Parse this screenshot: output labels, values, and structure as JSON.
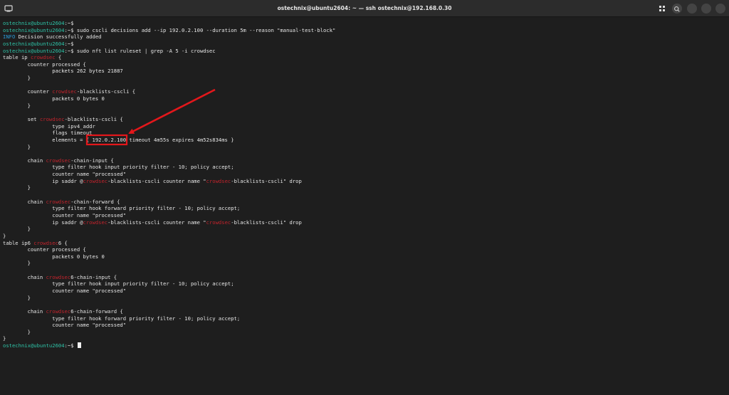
{
  "window": {
    "title": "ostechnix@ubuntu2604: ~ — ssh ostechnix@192.168.0.30"
  },
  "colors": {
    "prompt": "#2ec4a8",
    "info": "#2a9bd8",
    "highlight": "#c0232c",
    "annotation": "#e3171b"
  },
  "terminal": {
    "lines": [
      [
        {
          "t": "ostechnix@ubuntu2604",
          "c": "prompt"
        },
        {
          "t": ":~$"
        }
      ],
      [
        {
          "t": "ostechnix@ubuntu2604",
          "c": "prompt"
        },
        {
          "t": ":~$ sudo cscli decisions add --ip 192.0.2.100 --duration 5m --reason \"manual-test-block\""
        }
      ],
      [
        {
          "t": "INFO",
          "c": "info"
        },
        {
          "t": " Decision successfully added"
        }
      ],
      [
        {
          "t": "ostechnix@ubuntu2604",
          "c": "prompt"
        },
        {
          "t": ":~$"
        }
      ],
      [
        {
          "t": "ostechnix@ubuntu2604",
          "c": "prompt"
        },
        {
          "t": ":~$ sudo nft list ruleset | grep -A 5 -i crowdsec"
        }
      ],
      [
        {
          "t": "table ip "
        },
        {
          "t": "crowdsec",
          "c": "red"
        },
        {
          "t": " {"
        }
      ],
      [
        {
          "t": "        counter processed {"
        }
      ],
      [
        {
          "t": "                packets 262 bytes 21887"
        }
      ],
      [
        {
          "t": "        }"
        }
      ],
      [
        {
          "t": ""
        }
      ],
      [
        {
          "t": "        counter "
        },
        {
          "t": "crowdsec",
          "c": "red"
        },
        {
          "t": "-blacklists-cscli {"
        }
      ],
      [
        {
          "t": "                packets 0 bytes 0"
        }
      ],
      [
        {
          "t": "        }"
        }
      ],
      [
        {
          "t": ""
        }
      ],
      [
        {
          "t": "        set "
        },
        {
          "t": "crowdsec",
          "c": "red"
        },
        {
          "t": "-blacklists-cscli {"
        }
      ],
      [
        {
          "t": "                type ipv4_addr"
        }
      ],
      [
        {
          "t": "                flags timeout"
        }
      ],
      [
        {
          "t": "                elements = { 192.0.2.100 timeout 4m55s expires 4m52s834ms }"
        }
      ],
      [
        {
          "t": "        }"
        }
      ],
      [
        {
          "t": ""
        }
      ],
      [
        {
          "t": "        chain "
        },
        {
          "t": "crowdsec",
          "c": "red"
        },
        {
          "t": "-chain-input {"
        }
      ],
      [
        {
          "t": "                type filter hook input priority filter - 10; policy accept;"
        }
      ],
      [
        {
          "t": "                counter name \"processed\""
        }
      ],
      [
        {
          "t": "                ip saddr @"
        },
        {
          "t": "crowdsec",
          "c": "red"
        },
        {
          "t": "-blacklists-cscli counter name \""
        },
        {
          "t": "crowdsec",
          "c": "red"
        },
        {
          "t": "-blacklists-cscli\" drop"
        }
      ],
      [
        {
          "t": "        }"
        }
      ],
      [
        {
          "t": ""
        }
      ],
      [
        {
          "t": "        chain "
        },
        {
          "t": "crowdsec",
          "c": "red"
        },
        {
          "t": "-chain-forward {"
        }
      ],
      [
        {
          "t": "                type filter hook forward priority filter - 10; policy accept;"
        }
      ],
      [
        {
          "t": "                counter name \"processed\""
        }
      ],
      [
        {
          "t": "                ip saddr @"
        },
        {
          "t": "crowdsec",
          "c": "red"
        },
        {
          "t": "-blacklists-cscli counter name \""
        },
        {
          "t": "crowdsec",
          "c": "red"
        },
        {
          "t": "-blacklists-cscli\" drop"
        }
      ],
      [
        {
          "t": "        }"
        }
      ],
      [
        {
          "t": "}"
        }
      ],
      [
        {
          "t": "table ip6 "
        },
        {
          "t": "crowdsec",
          "c": "red"
        },
        {
          "t": "6 {"
        }
      ],
      [
        {
          "t": "        counter processed {"
        }
      ],
      [
        {
          "t": "                packets 0 bytes 0"
        }
      ],
      [
        {
          "t": "        }"
        }
      ],
      [
        {
          "t": ""
        }
      ],
      [
        {
          "t": "        chain "
        },
        {
          "t": "crowdsec",
          "c": "red"
        },
        {
          "t": "6-chain-input {"
        }
      ],
      [
        {
          "t": "                type filter hook input priority filter - 10; policy accept;"
        }
      ],
      [
        {
          "t": "                counter name \"processed\""
        }
      ],
      [
        {
          "t": "        }"
        }
      ],
      [
        {
          "t": ""
        }
      ],
      [
        {
          "t": "        chain "
        },
        {
          "t": "crowdsec",
          "c": "red"
        },
        {
          "t": "6-chain-forward {"
        }
      ],
      [
        {
          "t": "                type filter hook forward priority filter - 10; policy accept;"
        }
      ],
      [
        {
          "t": "                counter name \"processed\""
        }
      ],
      [
        {
          "t": "        }"
        }
      ],
      [
        {
          "t": "}"
        }
      ],
      [
        {
          "t": "ostechnix@ubuntu2604",
          "c": "prompt"
        },
        {
          "t": ":~$ "
        }
      ]
    ]
  }
}
